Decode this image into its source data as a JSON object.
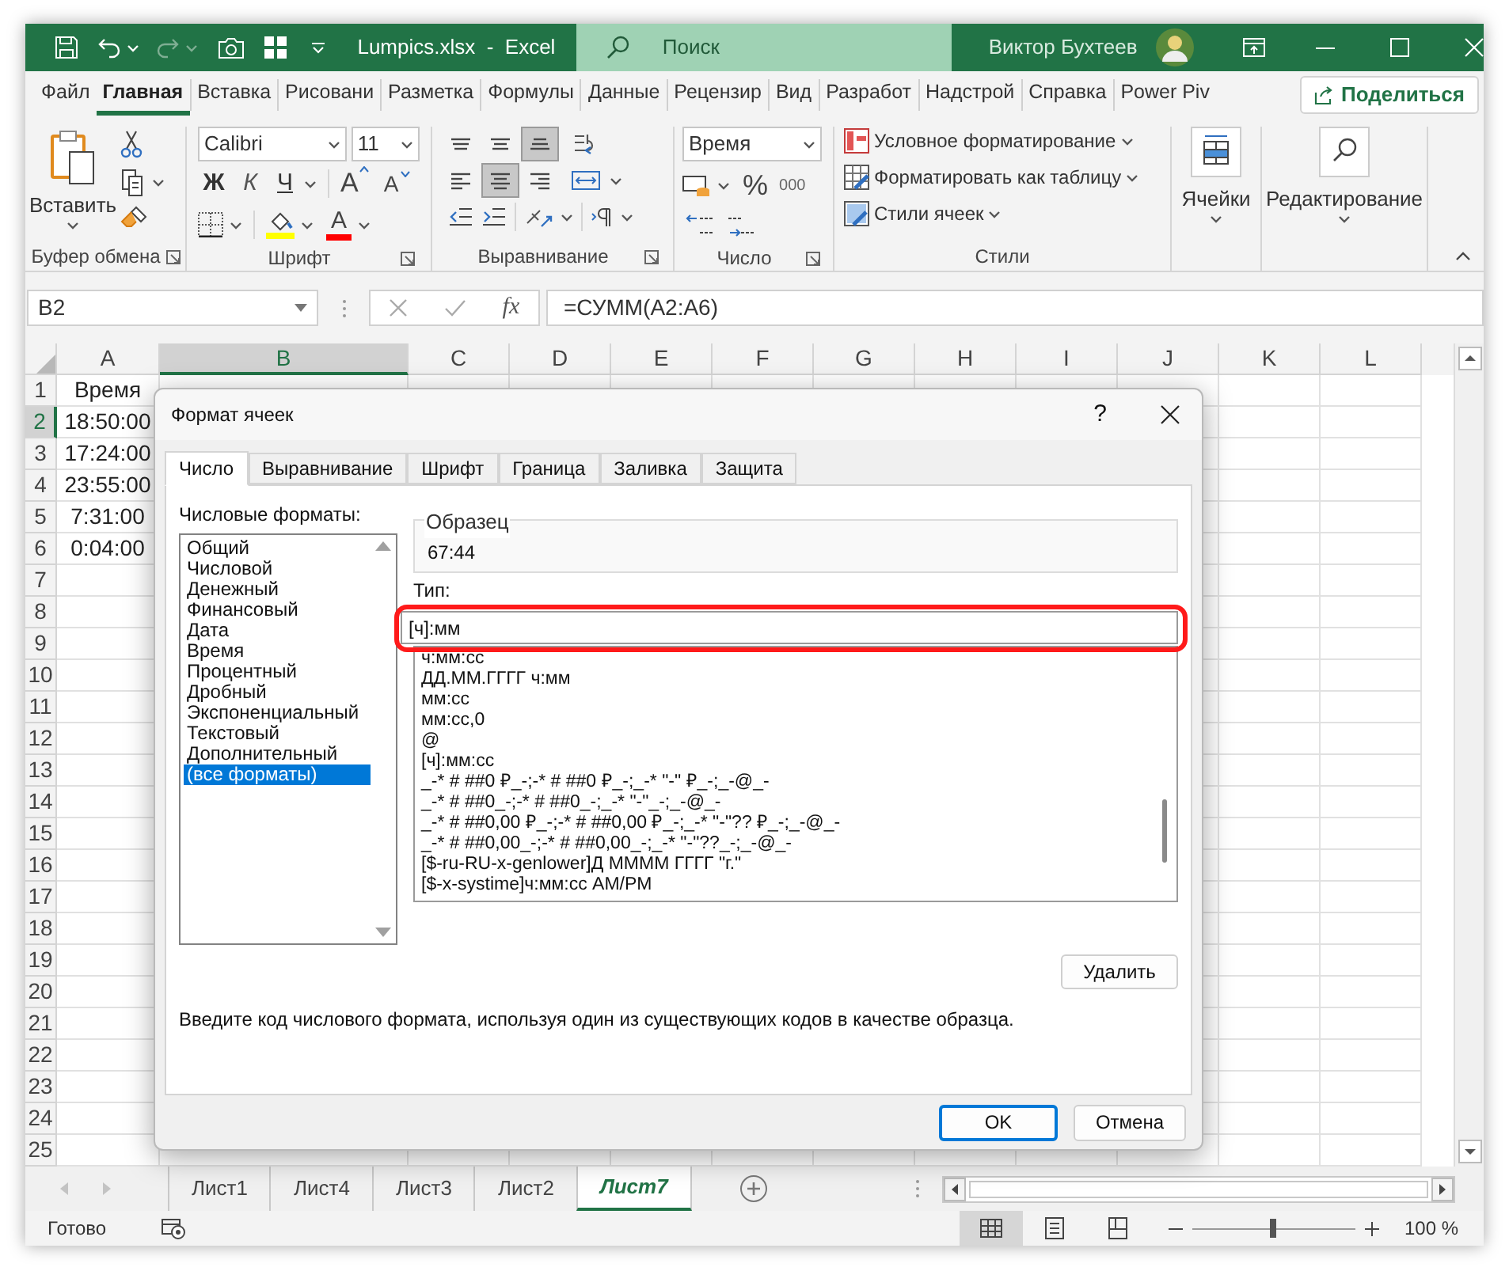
{
  "title_bar": {
    "file_title": "Lumpics.xlsx  -  Excel",
    "search_placeholder": "Поиск",
    "user_name": "Виктор Бухтеев"
  },
  "ribbon_tabs": [
    {
      "label": "Файл",
      "selected": false
    },
    {
      "label": "Главная",
      "selected": true
    },
    {
      "label": "Вставка",
      "selected": false
    },
    {
      "label": "Рисовани",
      "selected": false
    },
    {
      "label": "Разметка",
      "selected": false
    },
    {
      "label": "Формулы",
      "selected": false
    },
    {
      "label": "Данные",
      "selected": false
    },
    {
      "label": "Рецензир",
      "selected": false
    },
    {
      "label": "Вид",
      "selected": false
    },
    {
      "label": "Разработ",
      "selected": false
    },
    {
      "label": "Надстрой",
      "selected": false
    },
    {
      "label": "Справка",
      "selected": false
    },
    {
      "label": "Power Piv",
      "selected": false
    }
  ],
  "share_button": "Поделиться",
  "ribbon": {
    "clipboard": {
      "paste": "Вставить",
      "label": "Буфер обмена"
    },
    "font": {
      "font_name": "Calibri",
      "font_size": "11",
      "bold": "Ж",
      "italic": "К",
      "underline": "Ч",
      "grow": "A",
      "shrink": "A",
      "font_color": "A",
      "label": "Шрифт"
    },
    "alignment": {
      "buttons": [
        {
          "kind": "top",
          "selected": false
        },
        {
          "kind": "middle",
          "selected": false
        },
        {
          "kind": "bottom",
          "selected": true
        },
        {
          "kind": "left",
          "selected": false
        },
        {
          "kind": "center",
          "selected": true
        },
        {
          "kind": "right",
          "selected": false
        }
      ],
      "label": "Выравнивание"
    },
    "number": {
      "format": "Время",
      "percent": "%",
      "thousands": "000",
      "label": "Число"
    },
    "styles": {
      "items": [
        "Условное форматирование",
        "Форматировать как таблицу",
        "Стили ячеек"
      ],
      "label": "Стили"
    },
    "cells": {
      "label": "Ячейки"
    },
    "editing": {
      "label": "Редактирование"
    }
  },
  "formula_bar": {
    "name_box": "B2",
    "function_label": "fx",
    "formula": "=СУММ(A2:A6)"
  },
  "sheet": {
    "columns": [
      {
        "label": "A",
        "selected": false
      },
      {
        "label": "B",
        "selected": true
      },
      {
        "label": "C",
        "selected": false
      },
      {
        "label": "D",
        "selected": false
      },
      {
        "label": "E",
        "selected": false
      },
      {
        "label": "F",
        "selected": false
      },
      {
        "label": "G",
        "selected": false
      },
      {
        "label": "H",
        "selected": false
      },
      {
        "label": "I",
        "selected": false
      },
      {
        "label": "J",
        "selected": false
      },
      {
        "label": "K",
        "selected": false
      },
      {
        "label": "L",
        "selected": false
      }
    ],
    "rows": [
      {
        "header": "1",
        "selected": false,
        "cells": [
          "Время"
        ]
      },
      {
        "header": "2",
        "selected": true,
        "cells": [
          "18:50:00"
        ]
      },
      {
        "header": "3",
        "selected": false,
        "cells": [
          "17:24:00"
        ]
      },
      {
        "header": "4",
        "selected": false,
        "cells": [
          "23:55:00"
        ]
      },
      {
        "header": "5",
        "selected": false,
        "cells": [
          "7:31:00"
        ]
      },
      {
        "header": "6",
        "selected": false,
        "cells": [
          "0:04:00"
        ]
      },
      {
        "header": "7",
        "selected": false
      },
      {
        "header": "8",
        "selected": false
      },
      {
        "header": "9",
        "selected": false
      },
      {
        "header": "10",
        "selected": false
      },
      {
        "header": "11",
        "selected": false
      },
      {
        "header": "12",
        "selected": false
      },
      {
        "header": "13",
        "selected": false
      },
      {
        "header": "14",
        "selected": false
      },
      {
        "header": "15",
        "selected": false
      },
      {
        "header": "16",
        "selected": false
      },
      {
        "header": "17",
        "selected": false
      },
      {
        "header": "18",
        "selected": false
      },
      {
        "header": "19",
        "selected": false
      },
      {
        "header": "20",
        "selected": false
      },
      {
        "header": "21",
        "selected": false
      },
      {
        "header": "22",
        "selected": false
      },
      {
        "header": "23",
        "selected": false
      },
      {
        "header": "24",
        "selected": false
      },
      {
        "header": "25",
        "selected": false
      }
    ]
  },
  "dialog": {
    "title": "Формат ячеек",
    "help": "?",
    "tabs": [
      {
        "label": "Число",
        "selected": true
      },
      {
        "label": "Выравнивание",
        "selected": false
      },
      {
        "label": "Шрифт",
        "selected": false
      },
      {
        "label": "Граница",
        "selected": false
      },
      {
        "label": "Заливка",
        "selected": false
      },
      {
        "label": "Защита",
        "selected": false
      }
    ],
    "category_label": "Числовые форматы:",
    "categories": [
      {
        "label": "Общий",
        "selected": false
      },
      {
        "label": "Числовой",
        "selected": false
      },
      {
        "label": "Денежный",
        "selected": false
      },
      {
        "label": "Финансовый",
        "selected": false
      },
      {
        "label": "Дата",
        "selected": false
      },
      {
        "label": "Время",
        "selected": false
      },
      {
        "label": "Процентный",
        "selected": false
      },
      {
        "label": "Дробный",
        "selected": false
      },
      {
        "label": "Экспоненциальный",
        "selected": false
      },
      {
        "label": "Текстовый",
        "selected": false
      },
      {
        "label": "Дополнительный",
        "selected": false
      },
      {
        "label": "(все форматы)",
        "selected": true
      }
    ],
    "sample_label": "Образец",
    "sample_value": "67:44",
    "type_label": "Тип:",
    "type_value": "[ч]:мм",
    "type_highlighted": true,
    "formats": [
      "ч:мм:сс",
      "ДД.ММ.ГГГГ ч:мм",
      "мм:сс",
      "мм:сс,0",
      "@",
      "[ч]:мм:сс",
      "_-* # ##0 ₽_-;-* # ##0 ₽_-;_-* \"-\" ₽_-;_-@_-",
      "_-* # ##0_-;-* # ##0_-;_-* \"-\"_-;_-@_-",
      "_-* # ##0,00 ₽_-;-* # ##0,00 ₽_-;_-* \"-\"?? ₽_-;_-@_-",
      "_-* # ##0,00_-;-* # ##0,00_-;_-* \"-\"??_-;_-@_-",
      "[$-ru-RU-x-genlower]Д ММММ ГГГГ \"г.\"",
      "[$-x-systime]ч:мм:сс AM/PM"
    ],
    "delete_button": "Удалить",
    "description": "Введите код числового формата, используя один из существующих кодов в качестве образца.",
    "ok_button": "OK",
    "cancel_button": "Отмена"
  },
  "sheet_tabs": [
    {
      "label": "Лист1",
      "selected": false
    },
    {
      "label": "Лист4",
      "selected": false
    },
    {
      "label": "Лист3",
      "selected": false
    },
    {
      "label": "Лист2",
      "selected": false
    },
    {
      "label": "Лист7",
      "selected": true
    }
  ],
  "status_bar": {
    "status": "Готово",
    "view_buttons": [
      {
        "kind": "normal",
        "selected": true
      },
      {
        "kind": "page_layout",
        "selected": false
      },
      {
        "kind": "page_break",
        "selected": false
      }
    ],
    "zoom_slider": {
      "level": 0.5
    },
    "zoom": "100 %"
  }
}
